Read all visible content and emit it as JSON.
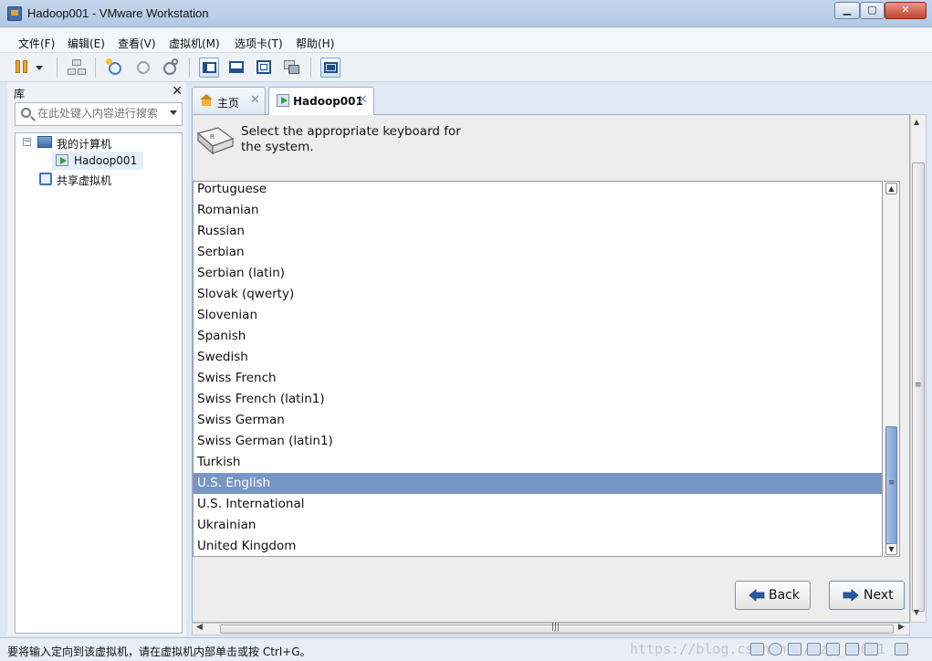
{
  "window": {
    "title": "Hadoop001 - VMware Workstation",
    "min": "▁",
    "max": "▢",
    "close": "✕"
  },
  "menu": [
    "文件(F)",
    "编辑(E)",
    "查看(V)",
    "虚拟机(M)",
    "选项卡(T)",
    "帮助(H)"
  ],
  "library": {
    "title": "库",
    "close": "✕",
    "search_placeholder": "在此处键入内容进行搜索",
    "tree": {
      "my_computer": "我的计算机",
      "vm": "Hadoop001",
      "shared": "共享虚拟机"
    }
  },
  "tabs": {
    "home": "主页",
    "vm": "Hadoop001",
    "close": "✕"
  },
  "guest": {
    "header": "Select the appropriate keyboard for the system.",
    "keyboards": [
      "Portuguese",
      "Romanian",
      "Russian",
      "Serbian",
      "Serbian (latin)",
      "Slovak (qwerty)",
      "Slovenian",
      "Spanish",
      "Swedish",
      "Swiss French",
      "Swiss French (latin1)",
      "Swiss German",
      "Swiss German (latin1)",
      "Turkish",
      "U.S. English",
      "U.S. International",
      "Ukrainian",
      "United Kingdom"
    ],
    "selected": "U.S. English",
    "back": "Back",
    "next": "Next"
  },
  "status": {
    "text": "要将输入定向到该虚拟机，请在虚拟机内部单击或按 Ctrl+G。",
    "watermark": "https://blog.csdn.net/hzj_10021"
  },
  "colors": {
    "selection": "#7896c5",
    "accent": "#3a74c4"
  }
}
